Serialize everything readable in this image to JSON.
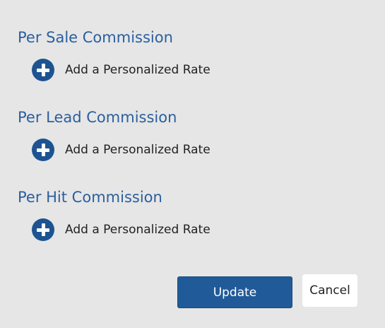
{
  "sections": [
    {
      "title": "Per Sale Commission",
      "add_label": "Add a Personalized Rate"
    },
    {
      "title": "Per Lead Commission",
      "add_label": "Add a Personalized Rate"
    },
    {
      "title": "Per Hit Commission",
      "add_label": "Add a Personalized Rate"
    }
  ],
  "actions": {
    "update_label": "Update",
    "cancel_label": "Cancel"
  },
  "colors": {
    "heading": "#2a5f9e",
    "accent": "#215a98",
    "background": "#e6e6e6"
  },
  "icons": {
    "add": "plus-circle-icon"
  }
}
